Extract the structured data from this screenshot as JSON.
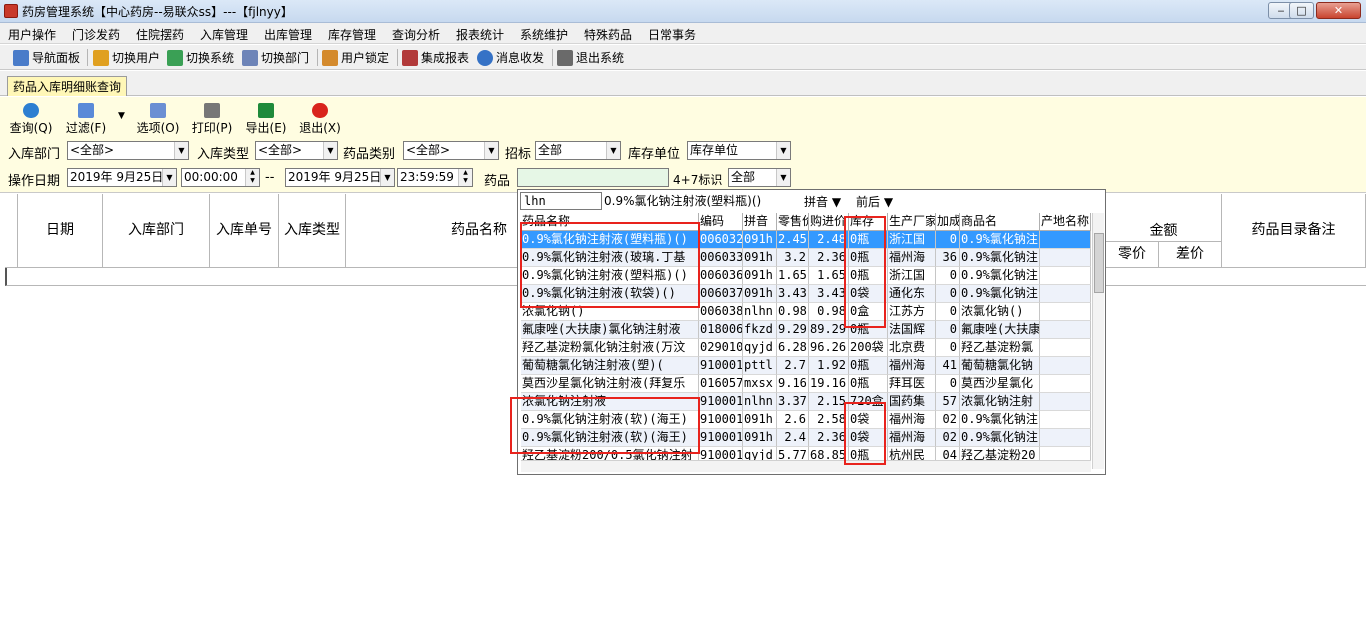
{
  "window": {
    "title": "药房管理系统【中心药房--易联众ss】---【fjlnyy】",
    "min": "‒",
    "max": "□",
    "close": "✕"
  },
  "menu": [
    "用户操作",
    "门诊发药",
    "住院摆药",
    "入库管理",
    "出库管理",
    "库存管理",
    "查询分析",
    "报表统计",
    "系统维护",
    "特殊药品",
    "日常事务"
  ],
  "toolbar": [
    {
      "label": "导航面板",
      "icon": "grid-icon",
      "color": "#4a7cc9"
    },
    {
      "label": "切换用户",
      "icon": "users-icon",
      "color": "#e0a020"
    },
    {
      "label": "切换系统",
      "icon": "switch-icon",
      "color": "#3aa055"
    },
    {
      "label": "切换部门",
      "icon": "dept-icon",
      "color": "#6d84b8"
    },
    {
      "label": "用户锁定",
      "icon": "lock-icon",
      "color": "#d48a2c"
    },
    {
      "label": "集成报表",
      "icon": "report-icon",
      "color": "#b23a3a"
    },
    {
      "label": "消息收发",
      "icon": "info-icon",
      "color": "#3572c6"
    },
    {
      "label": "退出系统",
      "icon": "exit-icon",
      "color": "#6a6a6a"
    }
  ],
  "tab": "药品入库明细账查询",
  "actions": [
    {
      "label": "查询(Q)",
      "icon": "refresh-icon",
      "color": "#2d7fd1"
    },
    {
      "label": "过滤(F)",
      "icon": "filter-icon",
      "color": "#5a8ad8"
    },
    {
      "label": "选项(O)",
      "icon": "options-icon",
      "color": "#6b8fd3"
    },
    {
      "label": "打印(P)",
      "icon": "printer-icon",
      "color": "#777777"
    },
    {
      "label": "导出(E)",
      "icon": "excel-icon",
      "color": "#1f8a3a"
    },
    {
      "label": "退出(X)",
      "icon": "power-icon",
      "color": "#d9241c"
    }
  ],
  "filters": {
    "dept_label": "入库部门",
    "dept_value": "<全部>",
    "type_label": "入库类型",
    "type_value": "<全部>",
    "cat_label": "药品类别",
    "cat_value": "<全部>",
    "bid_label": "招标",
    "bid_value": "全部",
    "unit_label": "库存单位",
    "unit_value": "库存单位",
    "date_label": "操作日期",
    "date_from": "2019年 9月25日",
    "time_from": "00:00:00",
    "sep": "--",
    "date_to": "2019年 9月25日",
    "time_to": "23:59:59",
    "drug_label": "药品",
    "flag_label": "4+7标识",
    "flag_value": "全部"
  },
  "grid_headers": {
    "date": "日期",
    "dept": "入库部门",
    "no": "入库单号",
    "type": "入库类型",
    "name": "药品名称",
    "amount": "金额",
    "retail": "零价",
    "diff": "差价",
    "remark": "药品目录备注"
  },
  "dropdown": {
    "search": "lhn",
    "current": "0.9%氯化钠注射液(塑料瓶)()",
    "pinyin": "拼音",
    "order": "前后",
    "columns": [
      "药品名称",
      "编码",
      "拼音",
      "零售价",
      "购进价",
      "库存",
      "生产厂家",
      "加成",
      "商品名",
      "产地名称"
    ],
    "rows": [
      [
        "0.9%氯化钠注射液(塑料瓶)()",
        "006032",
        "091h",
        "2.45",
        "2.48",
        "0瓶",
        "浙江国",
        "0",
        "0.9%氯化钠注",
        ""
      ],
      [
        "0.9%氯化钠注射液(玻璃.丁基",
        "006033",
        "091h",
        "3.2",
        "2.36",
        "0瓶",
        "福州海",
        "36",
        "0.9%氯化钠注",
        ""
      ],
      [
        "0.9%氯化钠注射液(塑料瓶)()",
        "006036",
        "091h",
        "1.65",
        "1.65",
        "0瓶",
        "浙江国",
        "0",
        "0.9%氯化钠注",
        ""
      ],
      [
        "0.9%氯化钠注射液(软袋)()",
        "006037",
        "091h",
        "3.43",
        "3.43",
        "0袋",
        "通化东",
        "0",
        "0.9%氯化钠注",
        ""
      ],
      [
        "浓氯化钠()",
        "006038",
        "nlhn",
        "0.98",
        "0.98",
        "0盒",
        "江苏方",
        "0",
        "浓氯化钠()",
        ""
      ],
      [
        "氟康唑(大扶康)氯化钠注射液",
        "018006",
        "fkzd",
        "9.29",
        "89.29",
        "0瓶",
        "法国辉",
        "0",
        "氟康唑(大扶康",
        ""
      ],
      [
        "羟乙基淀粉氯化钠注射液(万汶",
        "029010",
        "qyjd",
        "6.28",
        "96.26",
        "200袋",
        "北京费",
        "0",
        "羟乙基淀粉氯",
        ""
      ],
      [
        "葡萄糖氯化钠注射液(塑)(",
        "910001",
        "pttl",
        "2.7",
        "1.92",
        "0瓶",
        "福州海",
        "41",
        "葡萄糖氯化钠",
        ""
      ],
      [
        "莫西沙星氯化钠注射液(拜复乐",
        "016057",
        "mxsx",
        "9.16",
        "19.16",
        "0瓶",
        "拜耳医",
        "0",
        "莫西沙星氯化",
        ""
      ],
      [
        "浓氯化钠注射液",
        "910001",
        "nlhn",
        "3.37",
        "2.15",
        "720盒",
        "国药集",
        "57",
        "浓氯化钠注射",
        ""
      ],
      [
        "0.9%氯化钠注射液(软)(海王)",
        "910001",
        "091h",
        "2.6",
        "2.58",
        "0袋",
        "福州海",
        "02",
        "0.9%氯化钠注",
        ""
      ],
      [
        "0.9%氯化钠注射液(软)(海王)",
        "910001",
        "091h",
        "2.4",
        "2.36",
        "0袋",
        "福州海",
        "02",
        "0.9%氯化钠注",
        ""
      ],
      [
        "羟乙基淀粉200/0.5氯化钠注射",
        "910001",
        "qyjd",
        "5.77",
        "68.85",
        "0瓶",
        "杭州民",
        "04",
        "羟乙基淀粉20",
        ""
      ]
    ]
  }
}
